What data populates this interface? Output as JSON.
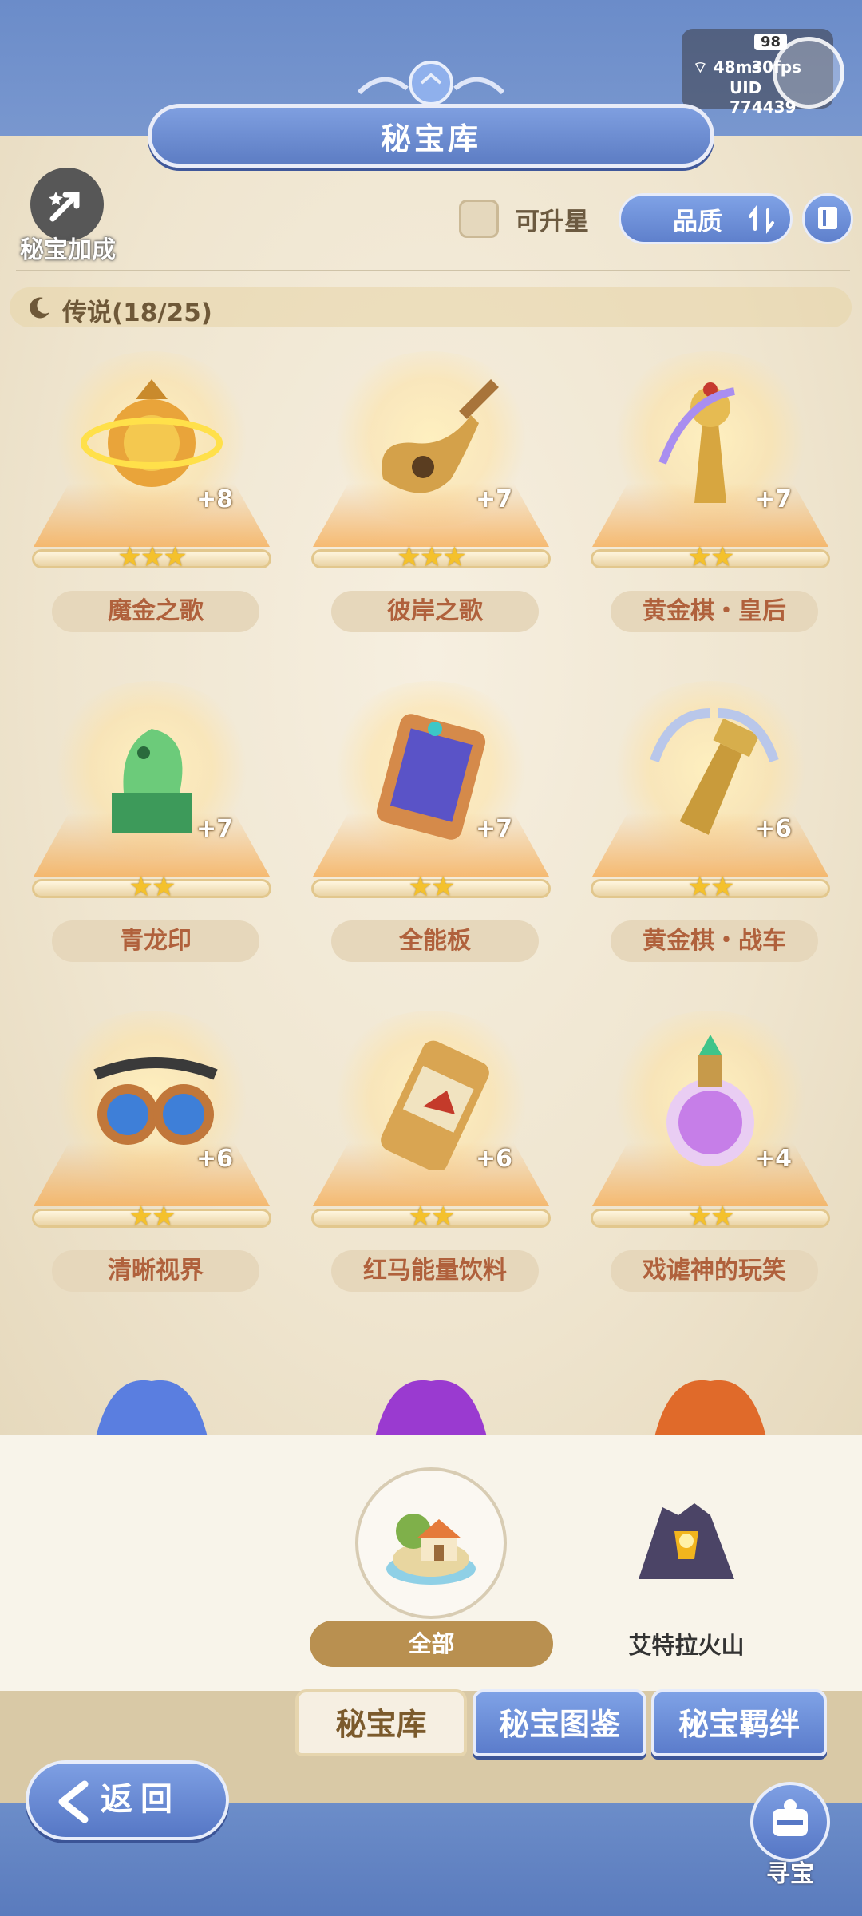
{
  "status": {
    "battery": "98",
    "ping": "48ms",
    "fps": "30fps",
    "uid": "UID 774439"
  },
  "header": {
    "title": "秘宝库",
    "bonus_label": "秘宝加成",
    "upgradable_label": "可升星",
    "sort_label": "品质"
  },
  "section": {
    "title": "传说(18/25)"
  },
  "items": [
    {
      "name": "魔金之歌",
      "level": "+8",
      "stars": "★★★",
      "icon": "golden-orb-icon"
    },
    {
      "name": "彼岸之歌",
      "level": "+7",
      "stars": "★★★",
      "icon": "lute-icon"
    },
    {
      "name": "黄金棋・皇后",
      "level": "+7",
      "stars": "★★",
      "icon": "chess-queen-icon"
    },
    {
      "name": "青龙印",
      "level": "+7",
      "stars": "★★",
      "icon": "jade-dragon-seal-icon"
    },
    {
      "name": "全能板",
      "level": "+7",
      "stars": "★★",
      "icon": "circuit-board-icon"
    },
    {
      "name": "黄金棋・战车",
      "level": "+6",
      "stars": "★★",
      "icon": "chess-rook-icon"
    },
    {
      "name": "清晰视界",
      "level": "+6",
      "stars": "★★",
      "icon": "goggles-icon"
    },
    {
      "name": "红马能量饮料",
      "level": "+6",
      "stars": "★★",
      "icon": "energy-can-icon"
    },
    {
      "name": "戏谑神的玩笑",
      "level": "+4",
      "stars": "★★",
      "icon": "potion-bottle-icon"
    }
  ],
  "filter": {
    "all_label": "全部",
    "volcano_label": "艾特拉火山"
  },
  "tabs": {
    "vault": "秘宝库",
    "codex": "秘宝图鉴",
    "bonds": "秘宝羁绊"
  },
  "footer": {
    "back_label": "返回",
    "treasure_label": "寻宝"
  },
  "colors": {
    "accent_blue": "#6b8cc9",
    "parchment": "#f0e6d0",
    "name_text": "#b0613c",
    "star_gold": "#f4c12c"
  }
}
